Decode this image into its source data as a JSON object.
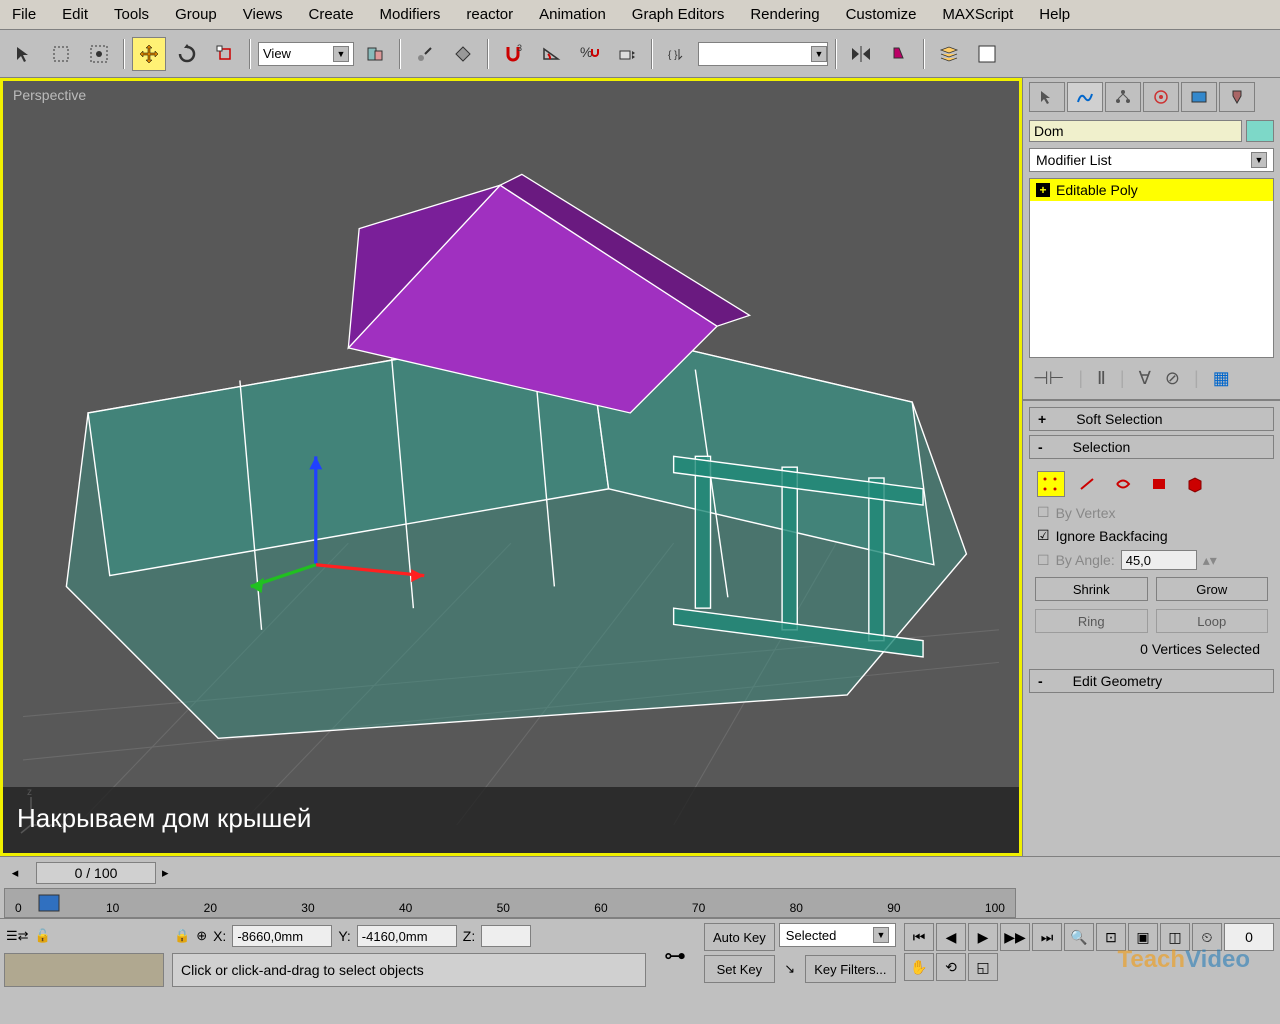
{
  "menu": [
    "File",
    "Edit",
    "Tools",
    "Group",
    "Views",
    "Create",
    "Modifiers",
    "reactor",
    "Animation",
    "Graph Editors",
    "Rendering",
    "Customize",
    "MAXScript",
    "Help"
  ],
  "toolbar": {
    "view_dd": "View"
  },
  "viewport": {
    "label": "Perspective",
    "subtitle": "Накрываем дом крышей"
  },
  "rpanel": {
    "object_name": "Dom",
    "modifier_list": "Modifier List",
    "stack_item": "Editable Poly",
    "rollouts": {
      "soft_sel": "Soft Selection",
      "selection": "Selection",
      "edit_geom": "Edit Geometry"
    },
    "by_vertex": "By Vertex",
    "ignore_bf": "Ignore Backfacing",
    "by_angle": "By Angle:",
    "angle_val": "45,0",
    "shrink": "Shrink",
    "grow": "Grow",
    "ring": "Ring",
    "loop": "Loop",
    "vert_sel": "0 Vertices Selected"
  },
  "timeline": {
    "frame": "0 / 100",
    "ticks": [
      "0",
      "10",
      "20",
      "30",
      "40",
      "50",
      "60",
      "70",
      "80",
      "90",
      "100"
    ]
  },
  "bottom": {
    "x_label": "X:",
    "x_val": "-8660,0mm",
    "y_label": "Y:",
    "y_val": "-4160,0mm",
    "z_label": "Z:",
    "z_val": "",
    "status": "Click or click-and-drag to select objects",
    "autokey": "Auto Key",
    "setkey": "Set Key",
    "keyfilters": "Key Filters...",
    "selected": "Selected"
  },
  "watermark": {
    "t1": "Teach",
    "t2": "Video"
  }
}
